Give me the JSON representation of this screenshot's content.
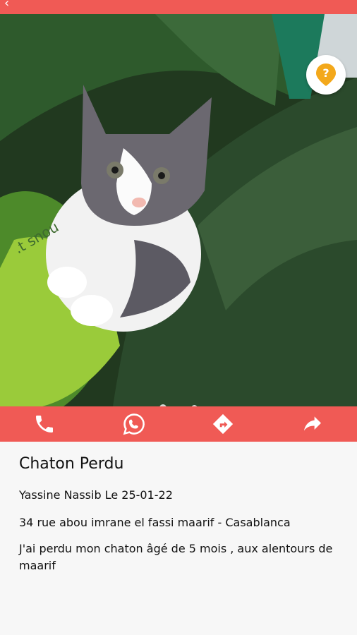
{
  "listing": {
    "title": "Chaton Perdu",
    "author_line": "Yassine Nassib Le 25-01-22",
    "address": "34 rue abou imrane el fassi maarif  - Casablanca",
    "description": "J'ai perdu mon chaton âgé de 5 mois , aux alentours de maarif",
    "photo_text": ".t snou"
  },
  "colors": {
    "accent": "#f05a55",
    "help": "#f3a81b"
  },
  "icons": {
    "back": "back-arrow-icon",
    "help": "help-icon",
    "call": "phone-icon",
    "whatsapp": "whatsapp-icon",
    "directions": "directions-icon",
    "share": "share-icon"
  },
  "carousel": {
    "count": 2,
    "active": 1
  }
}
